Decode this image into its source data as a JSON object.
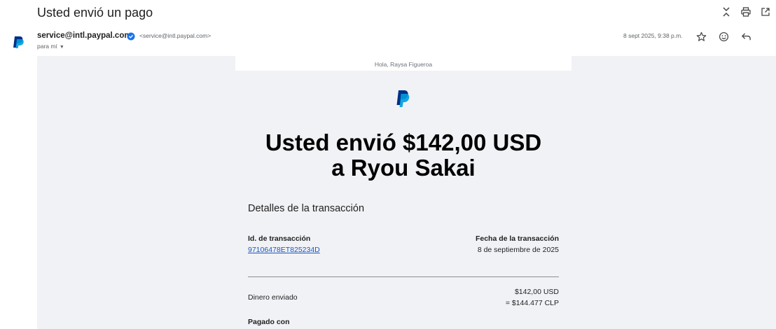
{
  "subject": "Usted envió un pago",
  "sender": {
    "name": "service@intl.paypal.com",
    "address": "<service@intl.paypal.com>",
    "to_label": "para mí",
    "date": "8 sept 2025, 9:38 p.m."
  },
  "icons": {
    "expand": "expand-collapse-icon",
    "print": "print-icon",
    "open_new": "open-in-new-window-icon",
    "star": "star-icon",
    "emoji": "emoji-reaction-icon",
    "reply": "reply-icon",
    "avatar": "paypal-logo-icon",
    "verified": "verified-badge-icon"
  },
  "email": {
    "greeting": "Hola, Raysa Figueroa",
    "headline_line1": "Usted envió $142,00 USD",
    "headline_line2": "a Ryou Sakai",
    "section_title": "Detalles de la transacción",
    "transaction_id_label": "Id. de transacción",
    "transaction_id": "97106478ET825234D",
    "transaction_date_label": "Fecha de la transacción",
    "transaction_date": "8 de septiembre de 2025",
    "sent_label": "Dinero enviado",
    "sent_amount": "$142,00 USD",
    "sent_converted": "= $144.477 CLP",
    "paid_with_label": "Pagado con"
  },
  "colors": {
    "paypal_dark_blue": "#003087",
    "paypal_light_blue": "#009cde",
    "link": "#1a56c2",
    "verified": "#1a73e8"
  }
}
